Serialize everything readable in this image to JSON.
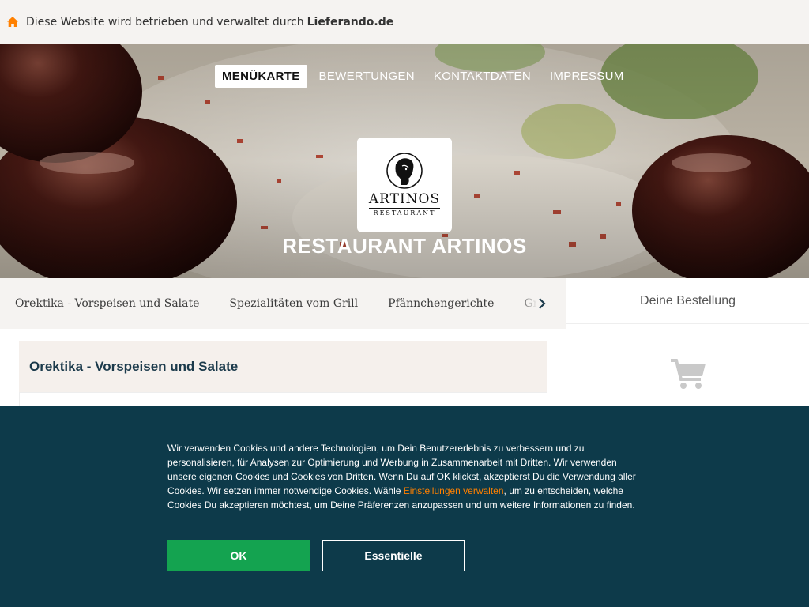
{
  "notice": {
    "text": "Diese Website wird betrieben und verwaltet durch",
    "brand": "Lieferando.de",
    "icon": "home-icon",
    "icon_color": "#ff8000"
  },
  "nav": {
    "items": [
      {
        "label": "MENÜKARTE",
        "active": true
      },
      {
        "label": "BEWERTUNGEN",
        "active": false
      },
      {
        "label": "KONTAKTDATEN",
        "active": false
      },
      {
        "label": "IMPRESSUM",
        "active": false
      }
    ]
  },
  "logo": {
    "brand": "ARTINOS",
    "sub": "RESTAURANT"
  },
  "restaurant_name": "RESTAURANT ARTINOS",
  "categories": [
    "Orektika - Vorspeisen und Salate",
    "Spezialitäten vom Grill",
    "Pfännchengerichte",
    "Grill"
  ],
  "order": {
    "title": "Deine Bestellung",
    "icon": "cart-icon"
  },
  "section": {
    "title": "Orektika - Vorspeisen und Salate"
  },
  "cookie": {
    "text_before_link": "Wir verwenden Cookies und andere Technologien, um Dein Benutzererlebnis zu verbessern und zu personalisieren, für Analysen zur Optimierung und Werbung in Zusammenarbeit mit Dritten. Wir verwenden unsere eigenen Cookies und Cookies von Dritten. Wenn Du auf OK klickst, akzeptierst Du die Verwendung aller Cookies. Wir setzen immer notwendige Cookies. Wähle ",
    "link": "Einstellungen verwalten",
    "text_after_link": ", um zu entscheiden, welche Cookies Du akzeptieren möchtest, um Deine Präferenzen anzupassen und um weitere Informationen zu finden.",
    "ok_label": "OK",
    "essential_label": "Essentielle",
    "colors": {
      "background": "#0d3a4a",
      "ok": "#14a350",
      "link": "#ff8000"
    }
  }
}
